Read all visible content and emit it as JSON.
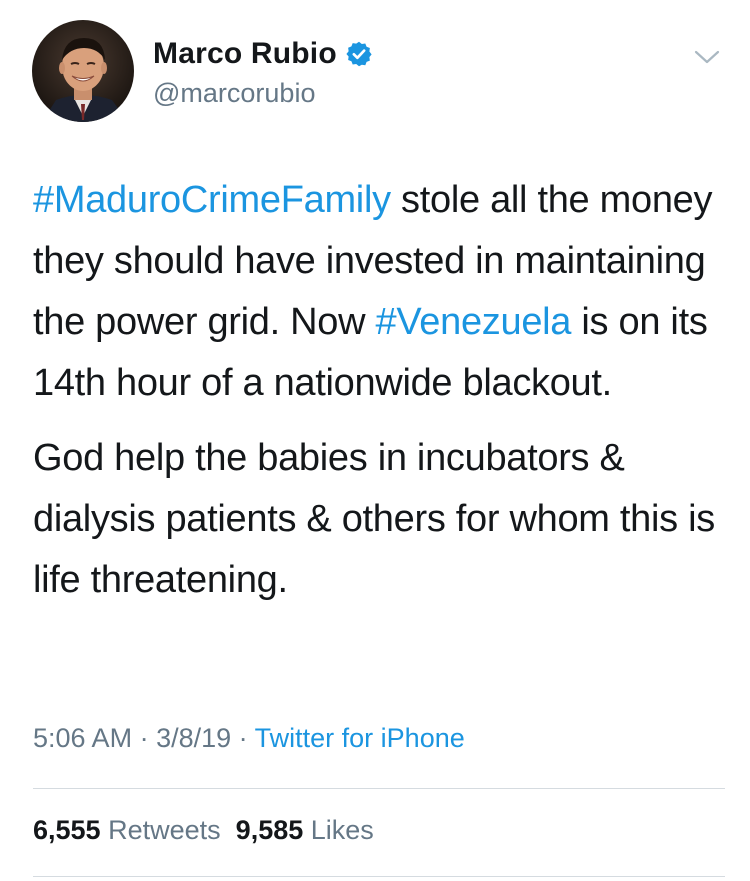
{
  "author": {
    "name": "Marco Rubio",
    "handle": "@marcorubio"
  },
  "tweet": {
    "paragraph1": {
      "hashtag1": "#MaduroCrimeFamily",
      "text1": " stole all the money they should have invested in maintaining the power grid. Now ",
      "hashtag2": "#Venezuela",
      "text2": " is on its 14th hour of a nationwide blackout."
    },
    "paragraph2": "God help the babies in incubators & dialysis patients & others for whom this is life threatening."
  },
  "meta": {
    "time": "5:06 AM",
    "separator": " · ",
    "date": "3/8/19",
    "source": "Twitter for iPhone"
  },
  "stats": {
    "retweets_count": "6,555",
    "retweets_label": "Retweets",
    "likes_count": "9,585",
    "likes_label": "Likes"
  },
  "colors": {
    "link": "#1b95e0",
    "secondary_text": "#657786",
    "primary_text": "#14171a",
    "divider": "#d5dbe0"
  },
  "icons": {
    "verified": "verified-badge-icon",
    "menu": "chevron-down-icon"
  }
}
